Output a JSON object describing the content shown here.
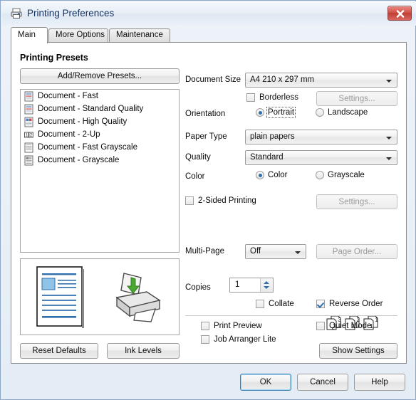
{
  "window": {
    "title": "Printing Preferences",
    "title_icon": "printer-icon",
    "close_label": "X"
  },
  "tabs": [
    {
      "label": "Main",
      "active": true
    },
    {
      "label": "More Options",
      "active": false
    },
    {
      "label": "Maintenance",
      "active": false
    }
  ],
  "presets": {
    "heading": "Printing Presets",
    "add_remove_label": "Add/Remove Presets...",
    "items": [
      {
        "label": "Document - Fast",
        "icon": "document-icon"
      },
      {
        "label": "Document - Standard Quality",
        "icon": "document-icon"
      },
      {
        "label": "Document - High Quality",
        "icon": "document-color-icon"
      },
      {
        "label": "Document - 2-Up",
        "icon": "two-up-icon"
      },
      {
        "label": "Document - Fast Grayscale",
        "icon": "document-gray-icon"
      },
      {
        "label": "Document - Grayscale",
        "icon": "document-gray-icon"
      }
    ]
  },
  "preview": {
    "document_icon": "document-preview-icon",
    "printer_icon": "printer-feed-icon"
  },
  "settings": {
    "document_size": {
      "label": "Document Size",
      "value": "A4 210 x 297 mm"
    },
    "borderless": {
      "label": "Borderless",
      "checked": false
    },
    "borderless_settings": {
      "label": "Settings...",
      "enabled": false
    },
    "orientation": {
      "label": "Orientation",
      "portrait": "Portrait",
      "landscape": "Landscape",
      "selected": "Portrait"
    },
    "paper_type": {
      "label": "Paper Type",
      "value": "plain papers"
    },
    "quality": {
      "label": "Quality",
      "value": "Standard"
    },
    "color": {
      "label": "Color",
      "color_option": "Color",
      "grayscale_option": "Grayscale",
      "selected": "Color"
    },
    "two_sided": {
      "label": "2-Sided Printing",
      "checked": false
    },
    "two_sided_settings": {
      "label": "Settings...",
      "enabled": false
    },
    "multi_page": {
      "label": "Multi-Page",
      "value": "Off"
    },
    "page_order": {
      "label": "Page Order...",
      "enabled": false
    },
    "copies": {
      "label": "Copies",
      "value": "1"
    },
    "collate": {
      "label": "Collate",
      "checked": false
    },
    "reverse_order": {
      "label": "Reverse Order",
      "checked": true
    },
    "print_preview": {
      "label": "Print Preview",
      "checked": false
    },
    "quiet_mode": {
      "label": "Quiet Mode",
      "checked": false
    },
    "job_arranger": {
      "label": "Job Arranger Lite",
      "checked": false
    },
    "page_order_icons": [
      "3",
      "2",
      "1"
    ]
  },
  "panel_buttons": {
    "reset_defaults": "Reset Defaults",
    "ink_levels": "Ink Levels",
    "show_settings": "Show Settings"
  },
  "dialog_buttons": {
    "ok": "OK",
    "cancel": "Cancel",
    "help": "Help"
  },
  "colors": {
    "accent": "#2f6fad",
    "title_text": "#13305e",
    "close_red": "#bf3e36",
    "focus_blue": "#3c7fb1"
  }
}
